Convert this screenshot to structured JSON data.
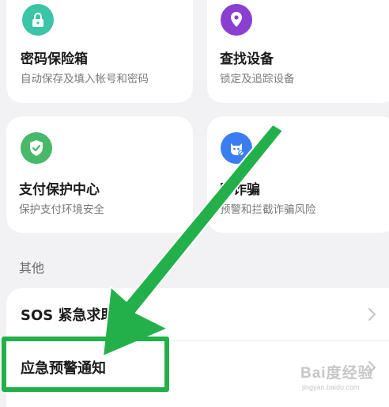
{
  "cards": [
    {
      "title": "密码保险箱",
      "subtitle": "自动保存及填入帐号和密码",
      "icon": "lock-icon",
      "color": "#3cc4a7"
    },
    {
      "title": "查找设备",
      "subtitle": "锁定及追踪设备",
      "icon": "location-pin-icon",
      "color": "#8a3fd1"
    },
    {
      "title": "支付保护中心",
      "subtitle": "保护支付环境安全",
      "icon": "shield-check-icon",
      "color": "#48b86a"
    },
    {
      "title": "防诈骗",
      "subtitle": "预警和拦截诈骗风险",
      "icon": "anti-fraud-icon",
      "color": "#3b7df0"
    }
  ],
  "section": {
    "label": "其他"
  },
  "list": [
    {
      "label": "SOS 紧急求助"
    },
    {
      "label": "应急预警通知"
    }
  ],
  "annotation": {
    "color": "#23b04a"
  },
  "watermark": {
    "main": "Bai度经验",
    "sub": "jingyan.baidu.com"
  }
}
